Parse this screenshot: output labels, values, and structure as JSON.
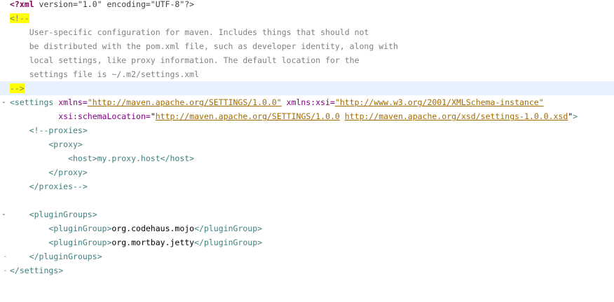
{
  "editor": {
    "xml_decl": {
      "open": "<?xml",
      "rest": " version=\"1.0\" encoding=\"UTF-8\"?>"
    },
    "comment_open": "<!--",
    "comment_lines": [
      "    User-specific configuration for maven. Includes things that should not",
      "    be distributed with the pom.xml file, such as developer identity, along with",
      "    local settings, like proxy information. The default location for the",
      "    settings file is ~/.m2/settings.xml"
    ],
    "comment_close": "-->",
    "settings_open": {
      "tag": "<settings",
      "xmlns_attr": " xmlns=",
      "xmlns_val": "\"http://maven.apache.org/SETTINGS/1.0.0\"",
      "xsi_attr": " xmlns:xsi=",
      "xsi_val": "\"http://www.w3.org/2001/XMLSchema-instance\"",
      "indent2": "          ",
      "schema_attr": "xsi:schemaLocation=",
      "schema_q1": "\"",
      "schema_url1": "http://maven.apache.org/SETTINGS/1.0.0",
      "schema_sp": " ",
      "schema_url2": "http://maven.apache.org/xsd/settings-1.0.0.xsd",
      "schema_q2": "\"",
      "close": ">"
    },
    "proxies_lines": [
      "    <!--proxies>",
      "        <proxy>",
      "            <host>my.proxy.host</host>",
      "        </proxy>",
      "    </proxies-->"
    ],
    "plugin_groups": {
      "open": "<pluginGroups>",
      "items": [
        {
          "open": "<pluginGroup>",
          "value": "org.codehaus.mojo",
          "close": "</pluginGroup>"
        },
        {
          "open": "<pluginGroup>",
          "value": "org.mortbay.jetty",
          "close": "</pluginGroup>"
        }
      ],
      "close": "</pluginGroups>"
    },
    "settings_close": "</settings>",
    "gutter": {
      "fold_minus": "-",
      "fold_bar": "|"
    }
  }
}
